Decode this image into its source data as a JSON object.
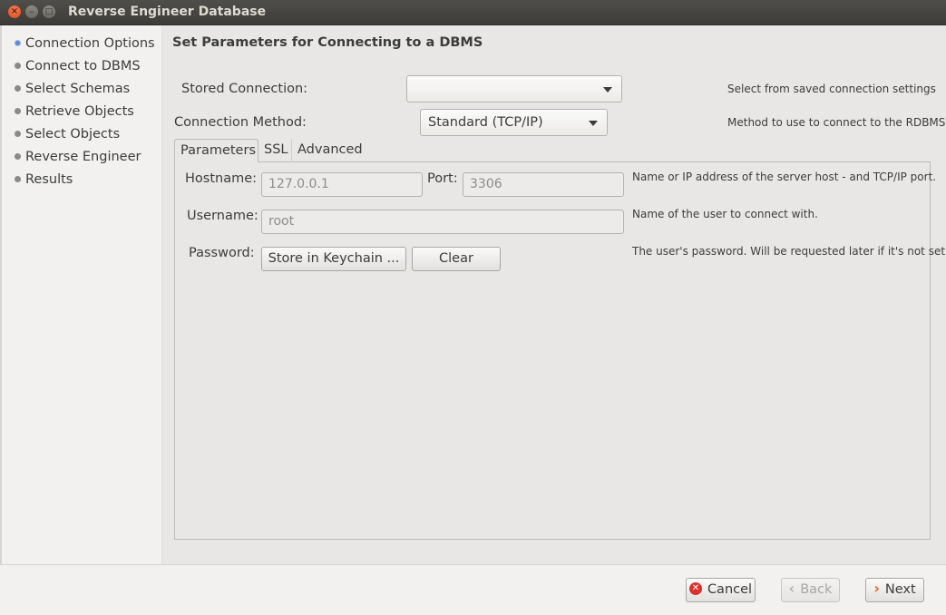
{
  "window": {
    "title": "Reverse Engineer Database",
    "close_glyph": "×",
    "min_glyph": "–",
    "max_glyph": "□"
  },
  "sidebar": {
    "items": [
      {
        "label": "Connection Options",
        "active": true
      },
      {
        "label": "Connect to DBMS"
      },
      {
        "label": "Select Schemas"
      },
      {
        "label": "Retrieve Objects"
      },
      {
        "label": "Select Objects"
      },
      {
        "label": "Reverse Engineer"
      },
      {
        "label": "Results"
      }
    ]
  },
  "page": {
    "heading": "Set Parameters for Connecting to a DBMS",
    "stored_connection": {
      "label": "Stored Connection:",
      "value": "",
      "hint": "Select from saved connection settings"
    },
    "connection_method": {
      "label": "Connection Method:",
      "value": "Standard (TCP/IP)",
      "hint": "Method to use to connect to the RDBMS"
    },
    "tabs": [
      {
        "label": "Parameters"
      },
      {
        "label": "SSL"
      },
      {
        "label": "Advanced"
      }
    ],
    "parameters": {
      "hostname": {
        "label": "Hostname:",
        "value": "127.0.0.1"
      },
      "port": {
        "label": "Port:",
        "value": "3306"
      },
      "host_hint": "Name or IP address of the server host - and TCP/IP port.",
      "username": {
        "label": "Username:",
        "value": "root",
        "hint": "Name of the user to connect with."
      },
      "password": {
        "label": "Password:",
        "store_button": "Store in Keychain ...",
        "clear_button": "Clear",
        "hint": "The user's password. Will be requested later if it's not set."
      }
    }
  },
  "footer": {
    "cancel": {
      "label": "Cancel",
      "icon": "cancel-icon"
    },
    "back": {
      "label": "Back",
      "icon": "chevron-left-icon",
      "enabled": false
    },
    "next": {
      "label": "Next",
      "icon": "chevron-right-icon"
    }
  },
  "colors": {
    "accent_dot": "#5b8ad0",
    "cancel_red": "#d9332e",
    "next_orange": "#e2661c"
  }
}
